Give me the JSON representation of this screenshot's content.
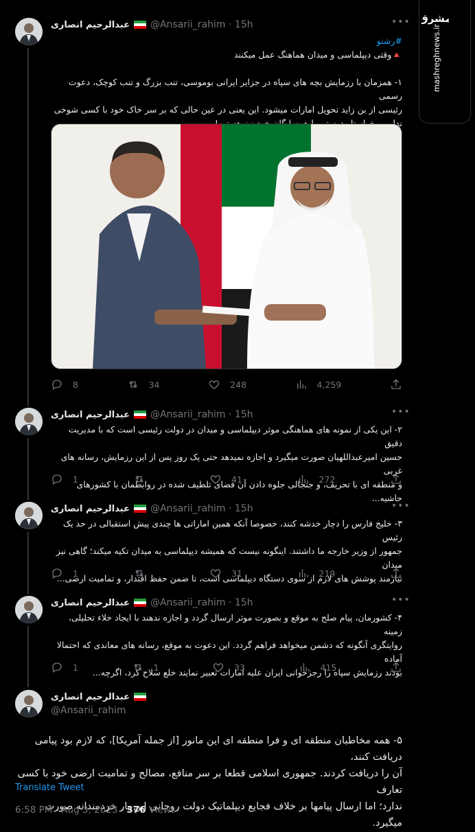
{
  "author": {
    "name": "عبدالرحیم انصاری",
    "handle": "@Ansarii_rahim",
    "handle_plain": "@Ansarii_rahim",
    "flag": "iran-flag"
  },
  "tweets": [
    {
      "time": "15h",
      "hashtag": "#رشتو",
      "lines": [
        "🔺وقتی دیپلماسی و میدان هماهنگ عمل میکنند",
        "",
        "۱- همزمان با رزمایش بچه های سپاه در جزایر ایرانی بوموسی، تنب بزرگ و تنب کوچک، دعوت رسمی",
        "رئیسی از بن زاید تحویل امارات میشود. این یعنی در عین حالی که بر سر خاک خود با کسی شوخی",
        "نداریم، خواستار دوستی با همسایگان خود نیز هستیم!"
      ],
      "stats": {
        "replies": "8",
        "retweets": "34",
        "likes": "248",
        "views": "4,259"
      }
    },
    {
      "time": "15h",
      "lines": [
        "۲- این یکی از نمونه های هماهنگی موثر دیپلماسی و میدان در دولت رئیسی است که با مدیریت دقیق",
        "حسین امیرعبداللهیان صورت میگیرد و اجازه نمیدهد حتی یک روز پس از این رزمایش، رسانه های غربی",
        "و منطقه ای با تحریف، و جنجالی جلوه دادن آن فضای تلطیف شده در روابطمان با کشورهای حاشیه..."
      ],
      "stats": {
        "replies": "1",
        "retweets": "",
        "likes": "41",
        "views": "272"
      }
    },
    {
      "time": "15h",
      "lines": [
        "۳- خلیج فارس را دچار خدشه کنند، خصوصا آنکه همین اماراتی ها چندی پیش استقبالی در حد یک رئیس",
        "جمهور از وزیر خارجه ما داشتند. اینگونه نیست که همیشه دیپلماسی به میدان تکیه میکند؛ گاهی نیز میدان",
        "نیازمند پوشش های لازم از سوی دستگاه دیپلماسی است، تا ضمن حفظ اقتدار، و تمامیت ارضی..."
      ],
      "stats": {
        "replies": "1",
        "retweets": "",
        "likes": "31",
        "views": "219"
      }
    },
    {
      "time": "15h",
      "lines": [
        "۴- کشورمان، پیام صلح به موقع و بصورت موثر ارسال گردد و اجازه ندهند با ایجاد خلاء تحلیلی، زمینه",
        "روایتگری آنگونه که دشمن میخواهد فراهم گردد. این دعوت به موقع، رسانه های معاندی که احتمالا آماده",
        "بودند رزمایش سپاه را رجزخوانی ایران علیه امارات تعبیر نمایند خلع سلاح کرد، اگرچه..."
      ],
      "stats": {
        "replies": "1",
        "retweets": "1",
        "likes": "33",
        "views": "415"
      }
    }
  ],
  "main_tweet": {
    "lines": [
      "۵- همه مخاطبان منطقه ای و فرا منطقه ای این مانور [از جمله آمریکا]، که لازم بود پیامی دریافت کنند،",
      "آن را دریافت کردند. جمهوری اسلامی قطعا بر سر منافع، مصالح و تمامیت ارضی خود با کسی تعارف",
      "ندارد؛ اما ارسال پیامها بر خلاف فجایع دیپلماتیک دولت روحانی این بار خردمندانه صورت میگیرد."
    ],
    "translate": "Translate Tweet",
    "timestamp": "6:58 PM · Aug 3, 2023 · ",
    "views_count": "376",
    "views_label": " Views"
  },
  "watermark": {
    "logo_text": "مشرق",
    "site": "mashreghnews.ir"
  },
  "colors": {
    "accent": "#1d9bf0",
    "muted": "#71767b",
    "background": "#000000"
  }
}
